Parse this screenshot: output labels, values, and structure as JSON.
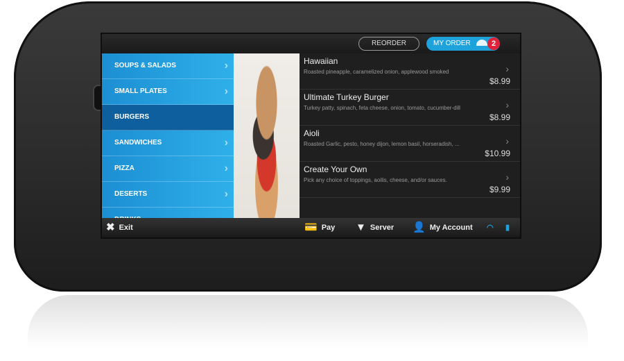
{
  "topbar": {
    "reorder": "REORDER",
    "my_order": "MY ORDER",
    "order_count": "2"
  },
  "sidebar": {
    "items": [
      {
        "label": "SOUPS & SALADS"
      },
      {
        "label": "SMALL PLATES"
      },
      {
        "label": "BURGERS",
        "active": true
      },
      {
        "label": "SANDWICHES"
      },
      {
        "label": "PIZZA"
      },
      {
        "label": "DESERTS"
      },
      {
        "label": "DRINKS"
      }
    ]
  },
  "menu": {
    "items": [
      {
        "name": "Hawaiian",
        "desc": "Roasted pineapple, caramelized onion, applewood smoked",
        "price": "$8.99"
      },
      {
        "name": "Ultimate Turkey Burger",
        "desc": "Turkey patty, spinach, feta cheese, onion, tomato, cucumber-dill",
        "price": "$8.99"
      },
      {
        "name": "Aioli",
        "desc": "Roasted Garlic, pesto, honey dijon, lemon basil, horseradish, ...",
        "price": "$10.99"
      },
      {
        "name": "Create Your Own",
        "desc": "Pick any choice of toppings, aoilis, cheese, and/or sauces.",
        "price": "$9.99"
      }
    ]
  },
  "bottombar": {
    "exit": "Exit",
    "pay": "Pay",
    "server": "Server",
    "account": "My Account"
  },
  "colors": {
    "accent": "#1ea2dc",
    "badge": "#e0213a",
    "sidebar": "#1c8fd3"
  }
}
